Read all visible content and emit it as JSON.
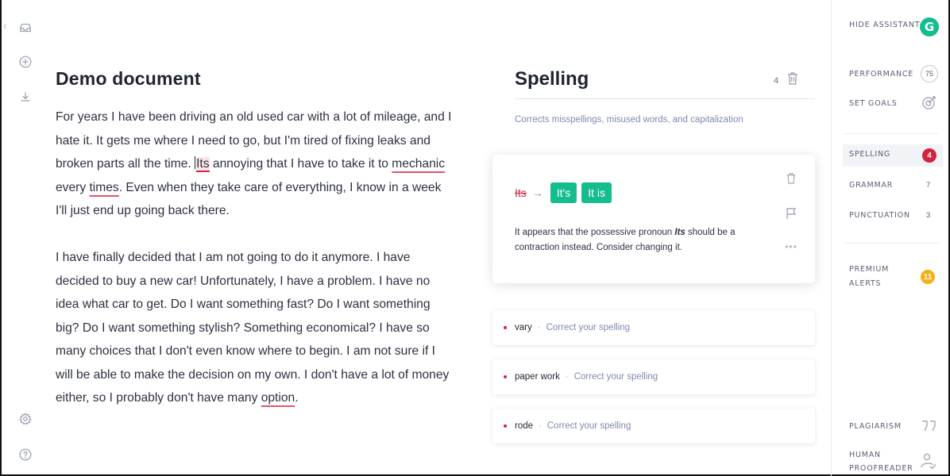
{
  "document": {
    "title": "Demo document",
    "p1": {
      "s1": "For years I have been driving an old used car with a lot of mileage, and I hate it. It gets me where I need to go, but I'm tired of fixing leaks and broken parts all the time.",
      "err_its": "Its",
      "s2": " annoying that I have to take it to ",
      "err_mechanic": "mechanic",
      "s3": " every ",
      "err_times": "times",
      "s4": ". Even when they take care of everything, I know in a week I'll just end up going back there."
    },
    "p2": {
      "s1": "I have finally decided that I am not going to do it anymore. I have decided to buy a new car! Unfortunately, I have a problem. I have no idea what car to get. Do I want something fast? Do I want something big? Do I want something stylish? Something economical? I have so many choices that I don't even know where to begin. I am not sure if I will be able to make the decision on my own. I don't have a lot of money either, so I probably don't have many ",
      "err_option": "option",
      "s2": "."
    }
  },
  "assistant": {
    "title": "Spelling",
    "count": "4",
    "subtitle": "Corrects misspellings, misused words, and capitalization",
    "active_card": {
      "original": "Its",
      "arrow": "→",
      "suggestions": [
        "It's",
        "It is"
      ],
      "desc_pre": "It appears that the possessive pronoun ",
      "desc_word": "Its",
      "desc_post": " should be a contraction instead. Consider changing it."
    },
    "alerts": [
      {
        "word": "vary",
        "sep": "·",
        "hint": "Correct your spelling"
      },
      {
        "word": "paper work",
        "sep": "·",
        "hint": "Correct your spelling"
      },
      {
        "word": "rode",
        "sep": "·",
        "hint": "Correct your spelling"
      }
    ]
  },
  "sidebar": {
    "hide_assistant": "HIDE ASSISTANT",
    "logo_letter": "G",
    "performance": "PERFORMANCE",
    "performance_score": "75",
    "set_goals": "SET GOALS",
    "spelling": "SPELLING",
    "spelling_count": "4",
    "grammar": "GRAMMAR",
    "grammar_count": "7",
    "punctuation": "PUNCTUATION",
    "punctuation_count": "3",
    "premium_line1": "PREMIUM",
    "premium_line2": "ALERTS",
    "premium_count": "11",
    "plagiarism": "PLAGIARISM",
    "proofreader_line1": "HUMAN",
    "proofreader_line2": "PROOFREADER"
  },
  "colors": {
    "accent_green": "#15bd8e",
    "error_red": "#d3233e",
    "premium_orange": "#f5b014",
    "muted_blue": "#7f88b0"
  },
  "icons": {
    "rail": [
      "chevron-left-icon",
      "inbox-icon",
      "plus-circle-icon",
      "download-icon",
      "settings-icon",
      "help-icon"
    ],
    "panel": [
      "trash-icon",
      "flag-icon",
      "more-icon",
      "target-icon",
      "quote-icon",
      "person-check-icon"
    ]
  }
}
